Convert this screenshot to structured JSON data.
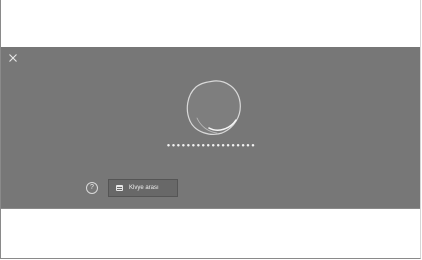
{
  "icons": {
    "close": "close-icon",
    "help": "help-icon",
    "keyboard": "keyboard-icon"
  },
  "colors": {
    "overlay_bg": "#777777",
    "frame_bg": "#ffffff",
    "button_bg": "#686868",
    "text_light": "#f2f2f2"
  },
  "lock": {
    "password_mask": "••••••••••••••••••",
    "help_symbol": "?",
    "keyboard_button_label": "Klvye arası"
  }
}
